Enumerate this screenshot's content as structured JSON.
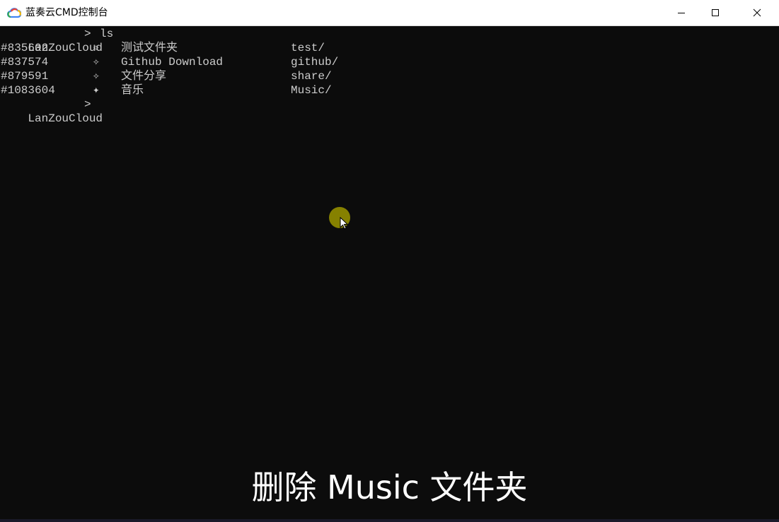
{
  "window": {
    "title": "蓝奏云CMD控制台",
    "icon": "cloud-icon",
    "controls": [
      "minimize-icon",
      "maximize-icon",
      "close-icon"
    ]
  },
  "terminal": {
    "command_line": {
      "prompt": "LanZouCloud",
      "arrow": ">",
      "command": "ls"
    },
    "rows": [
      {
        "id": "#835602",
        "star": "✧",
        "name": "测试文件夹",
        "path": "test/"
      },
      {
        "id": "#837574",
        "star": "✧",
        "name": "Github Download",
        "path": "github/"
      },
      {
        "id": "#879591",
        "star": "✧",
        "name": "文件分享",
        "path": "share/"
      },
      {
        "id": "#1083604",
        "star": "✦",
        "name": "音乐",
        "path": "Music/"
      }
    ],
    "prompt_line": {
      "prompt": "LanZouCloud",
      "arrow": ">"
    }
  },
  "subtitle": "删除 Music 文件夹",
  "colors": {
    "terminal_bg": "#0c0c0c",
    "terminal_text": "#cccccc",
    "cursor_highlight": "#8d8800"
  }
}
